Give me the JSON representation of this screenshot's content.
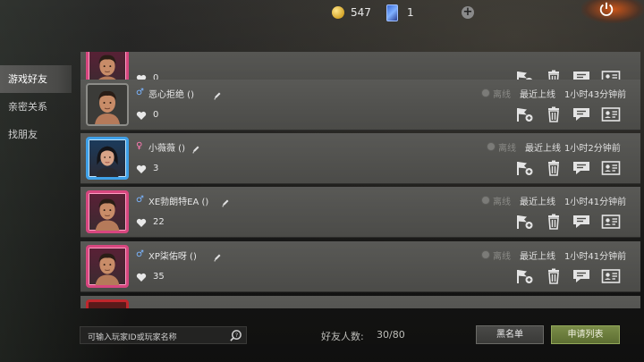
{
  "topbar": {
    "coins": "547",
    "cards": "1",
    "coin_icon": "gold-coin-icon",
    "card_icon": "card-icon",
    "add_icon": "plus-icon",
    "power_icon": "power-icon"
  },
  "tabs": [
    {
      "label": "游戏好友",
      "active": true
    },
    {
      "label": "亲密关系",
      "active": false
    },
    {
      "label": "找朋友",
      "active": false
    }
  ],
  "friends": [
    {
      "gender": "♂",
      "name": "",
      "hearts": "0",
      "status": "",
      "last_label": "",
      "last_value": "",
      "frame": "pink"
    },
    {
      "gender": "♂",
      "name": "恶心拒绝 ()",
      "hearts": "0",
      "status": "离线",
      "last_label": "最近上线",
      "last_value": "1小时43分钟前",
      "frame": "plain"
    },
    {
      "gender": "♀",
      "name": "小薇薇 ()",
      "hearts": "3",
      "status": "离线",
      "last_label": "最近上线",
      "last_value": "1小时2分钟前",
      "frame": "blue"
    },
    {
      "gender": "♂",
      "name": "XE勃朗特EA ()",
      "hearts": "22",
      "status": "离线",
      "last_label": "最近上线",
      "last_value": "1小时41分钟前",
      "frame": "pink"
    },
    {
      "gender": "♂",
      "name": "XP柒佑呀 ()",
      "hearts": "35",
      "status": "离线",
      "last_label": "最近上线",
      "last_value": "1小时41分钟前",
      "frame": "pink"
    }
  ],
  "bottom": {
    "search_placeholder": "可输入玩家ID或玩家名称",
    "friend_count_label": "好友人数:",
    "friend_count_value": "30/80",
    "blacklist_button": "黑名单",
    "apply_list_button": "申请列表"
  },
  "colors": {
    "accent_green": "#7a8c48",
    "pink_frame": "#d7467f",
    "blue_frame": "#3fa0e8"
  }
}
